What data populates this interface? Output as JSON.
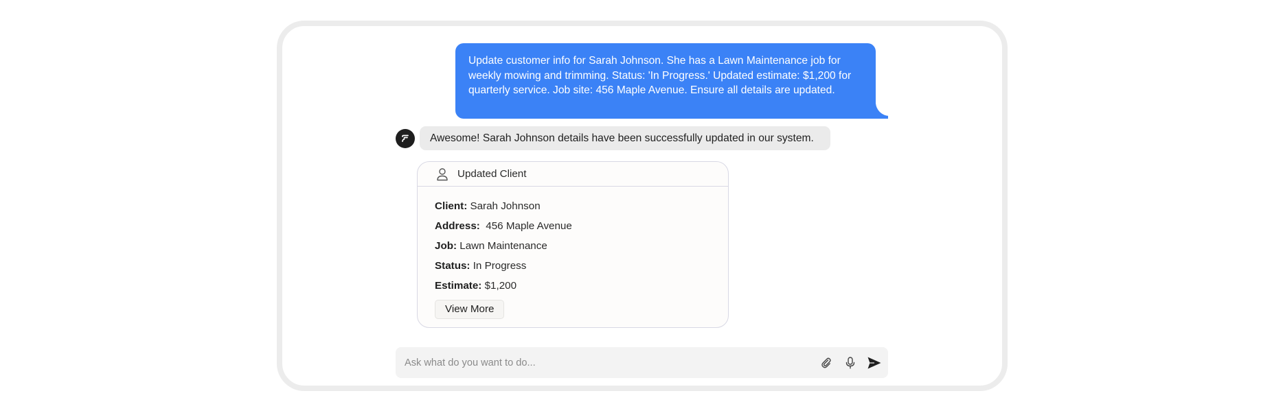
{
  "conversation": {
    "user_message": "Update customer info for Sarah Johnson. She has a Lawn Maintenance job for weekly mowing and trimming. Status: 'In Progress.' Updated estimate: $1,200 for quarterly service. Job site: 456 Maple Avenue. Ensure all details are updated.",
    "assistant_message": "Awesome! Sarah Johnson details have been successfully updated in our system."
  },
  "card": {
    "icon": "user-icon",
    "title": "Updated Client",
    "fields": [
      {
        "label": "Client:",
        "value": " Sarah Johnson"
      },
      {
        "label": "Address:",
        "value": "  456 Maple Avenue"
      },
      {
        "label": "Job:",
        "value": " Lawn Maintenance"
      },
      {
        "label": "Status:",
        "value": " In Progress"
      },
      {
        "label": "Estimate:",
        "value": " $1,200"
      }
    ],
    "view_more_label": "View More"
  },
  "composer": {
    "placeholder": "Ask what do you want to do...",
    "icons": [
      "paperclip-icon",
      "microphone-icon",
      "send-icon"
    ]
  },
  "colors": {
    "user_bubble": "#3b82f6",
    "assistant_bubble": "#ebebeb",
    "avatar": "#1e1e1e",
    "frame_border": "#ececec"
  }
}
